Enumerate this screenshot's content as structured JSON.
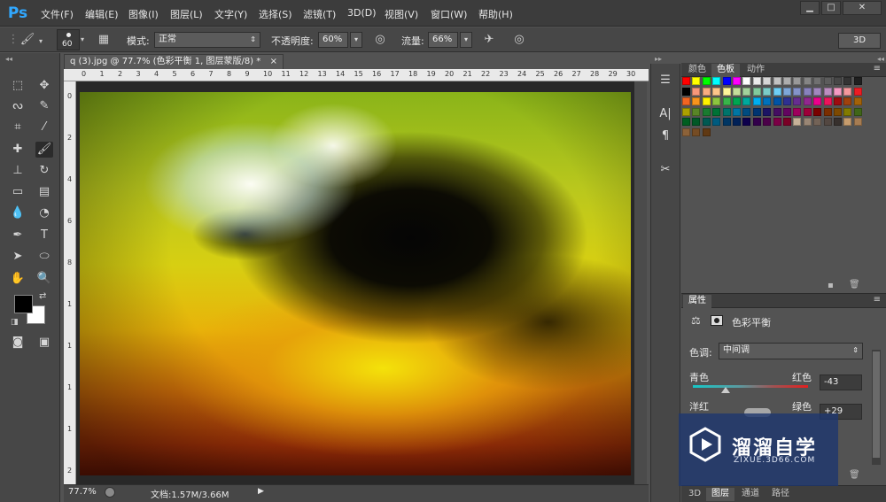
{
  "app": {
    "logo": "Ps"
  },
  "menu": [
    "文件(F)",
    "编辑(E)",
    "图像(I)",
    "图层(L)",
    "文字(Y)",
    "选择(S)",
    "滤镜(T)",
    "3D(D)",
    "视图(V)",
    "窗口(W)",
    "帮助(H)"
  ],
  "window_controls": [
    "minimize-icon",
    "maximize-icon",
    "close-icon"
  ],
  "options": {
    "brush_size": "60",
    "mode_label": "模式:",
    "mode_value": "正常",
    "opacity_label": "不透明度:",
    "opacity_value": "60%",
    "flow_label": "流量:",
    "flow_value": "66%",
    "workspace": "3D"
  },
  "document": {
    "tab_title": "q (3).jpg @ 77.7% (色彩平衡 1, 图层蒙版/8) *",
    "tab_close": "×",
    "ruler_top": [
      "0",
      "1",
      "2",
      "3",
      "4",
      "5",
      "6",
      "7",
      "8",
      "9",
      "10",
      "11",
      "12",
      "13",
      "14",
      "15",
      "16",
      "17",
      "18",
      "19",
      "20",
      "21",
      "22",
      "23",
      "24",
      "25",
      "26",
      "27",
      "28",
      "29",
      "30"
    ],
    "ruler_left": [
      "0",
      "2",
      "4",
      "6",
      "8",
      "1",
      "1",
      "1",
      "1",
      "2"
    ],
    "zoom": "77.7%",
    "doc_info": "文档:1.57M/3.66M"
  },
  "swatches_panel": {
    "tabs": [
      "颜色",
      "色板",
      "动作"
    ],
    "active_tab": "色板",
    "rows": [
      [
        "#ff0000",
        "#ffff00",
        "#00ff00",
        "#00ffff",
        "#0000ff",
        "#ff00ff",
        "#ffffff",
        "#ebebeb",
        "#d6d6d6",
        "#c2c2c2",
        "#adadad",
        "#999999",
        "#858585",
        "#707070",
        "#5c5c5c",
        "#474747",
        "#333333",
        "#1f1f1f"
      ],
      [
        "#000000",
        "#f7977a",
        "#f9ad81",
        "#fdc68a",
        "#fff79a",
        "#c4df9b",
        "#a3d39c",
        "#82ca9d",
        "#7bcdc8",
        "#6ecff6",
        "#7ea7d8",
        "#8493ca",
        "#8882be",
        "#a187be",
        "#bc8dbf",
        "#f49ac2",
        "#f6989d",
        "#ed1c24"
      ],
      [
        "#f26522",
        "#f7941d",
        "#fff200",
        "#8dc63f",
        "#39b54a",
        "#00a651",
        "#00a99d",
        "#00aeef",
        "#0072bc",
        "#0054a6",
        "#2e3192",
        "#662d91",
        "#92278f",
        "#ec008c",
        "#ed145b",
        "#9e0b0f",
        "#a0410d",
        "#a36209"
      ],
      [
        "#aba000",
        "#598527",
        "#1a7b30",
        "#007236",
        "#00746b",
        "#0076a3",
        "#004b80",
        "#003471",
        "#1b1464",
        "#440e62",
        "#630460",
        "#9e005d",
        "#9e0039",
        "#790000",
        "#7b2e00",
        "#7d4900",
        "#827b00",
        "#406618"
      ],
      [
        "#005e20",
        "#005826",
        "#005952",
        "#005b7f",
        "#003663",
        "#002157",
        "#0d004c",
        "#32004b",
        "#4b0049",
        "#7b0046",
        "#7a0026",
        "#c7b299",
        "#998675",
        "#736357",
        "#534741",
        "#37302d",
        "#c69c6d",
        "#a67c52"
      ],
      [
        "#8c6239",
        "#754c24",
        "#603913"
      ]
    ]
  },
  "properties": {
    "title": "属性",
    "adjustment_name": "色彩平衡",
    "tone_label": "色调:",
    "tone_value": "中间调",
    "cyan_label": "青色",
    "red_label": "红色",
    "cyan_red_value": "-43",
    "magenta_label": "洋红",
    "green_label": "绿色",
    "magenta_green_value": "+29"
  },
  "layers_tabs": [
    "3D",
    "图层",
    "通道",
    "路径"
  ],
  "watermark": {
    "title": "溜溜自学",
    "url": "ZIXUE.3D66.COM"
  }
}
